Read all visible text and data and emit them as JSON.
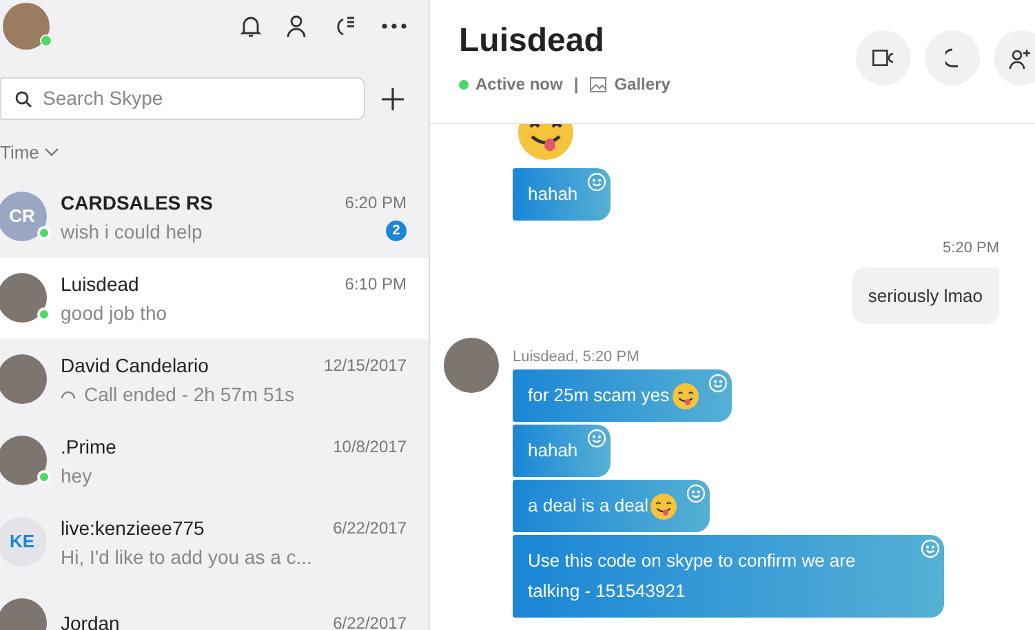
{
  "sidebar": {
    "profile": {
      "online": true
    },
    "search": {
      "placeholder": "Search Skype"
    },
    "sort": {
      "label": "Time"
    },
    "chats": [
      {
        "name": "CARDSALES RS",
        "time": "6:20 PM",
        "preview": "wish i could help",
        "initials": "CR",
        "online": true,
        "unread": "2",
        "selected": false
      },
      {
        "name": "Luisdead",
        "time": "6:10 PM",
        "preview": "good job tho",
        "online": true,
        "selected": true
      },
      {
        "name": "David Candelario",
        "time": "12/15/2017",
        "preview": "Call ended - 2h 57m 51s",
        "call": true,
        "online": false,
        "selected": false
      },
      {
        "name": ".Prime",
        "time": "10/8/2017",
        "preview": "hey",
        "online": true,
        "selected": false
      },
      {
        "name": "live:kenzieee775",
        "time": "6/22/2017",
        "preview": "Hi, I'd like to add you as a c...",
        "initials": "KE",
        "online": false,
        "selected": false
      },
      {
        "name": "Jordan",
        "time": "6/22/2017",
        "online": false,
        "selected": false
      }
    ]
  },
  "conversation": {
    "title": "Luisdead",
    "status": "Active now",
    "separator": "|",
    "gallery": "Gallery",
    "messages": [
      {
        "kind": "sticker"
      },
      {
        "kind": "incoming",
        "bubbles": [
          {
            "text": "hahah"
          }
        ]
      },
      {
        "kind": "time",
        "text": "5:20 PM"
      },
      {
        "kind": "outgoing",
        "text": "seriously lmao"
      },
      {
        "kind": "group",
        "sender": "Luisdead, 5:20 PM",
        "bubbles": [
          {
            "text": "for 25m scam yes",
            "emoji": true
          },
          {
            "text": "hahah"
          },
          {
            "text": "a deal is a deal",
            "emoji": true
          },
          {
            "text": "Use this code on skype to confirm we are talking - 151543921"
          }
        ]
      }
    ]
  }
}
